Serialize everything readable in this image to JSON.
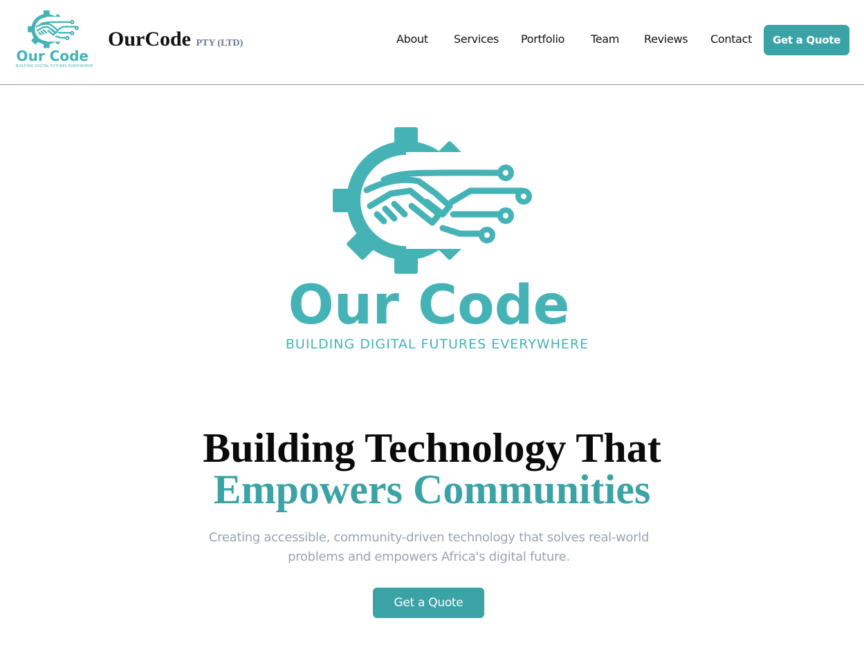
{
  "brand": {
    "logo_wordmark": "Our Code",
    "logo_tagline": "BUILDING DIGITAL FUTURES EVERYWHERE",
    "name": "OurCode",
    "suffix": "PTY (LTD)",
    "logo_icon": "gear-handshake-circuit-icon"
  },
  "nav": {
    "items": [
      {
        "label": "About"
      },
      {
        "label": "Services"
      },
      {
        "label": "Portfolio"
      },
      {
        "label": "Team"
      },
      {
        "label": "Reviews"
      },
      {
        "label": "Contact"
      }
    ],
    "cta_label": "Get a Quote"
  },
  "hero": {
    "title_line1": "Building Technology That",
    "title_line2": "Empowers Communities",
    "subtitle": "Creating accessible, community-driven technology that solves real-world problems and empowers Africa's digital future.",
    "cta_label": "Get a Quote"
  },
  "colors": {
    "accent": "#3ba3a6",
    "logo_teal": "#45b3b6",
    "text_dark": "#0a0a0a",
    "text_muted": "#9aa3af"
  }
}
